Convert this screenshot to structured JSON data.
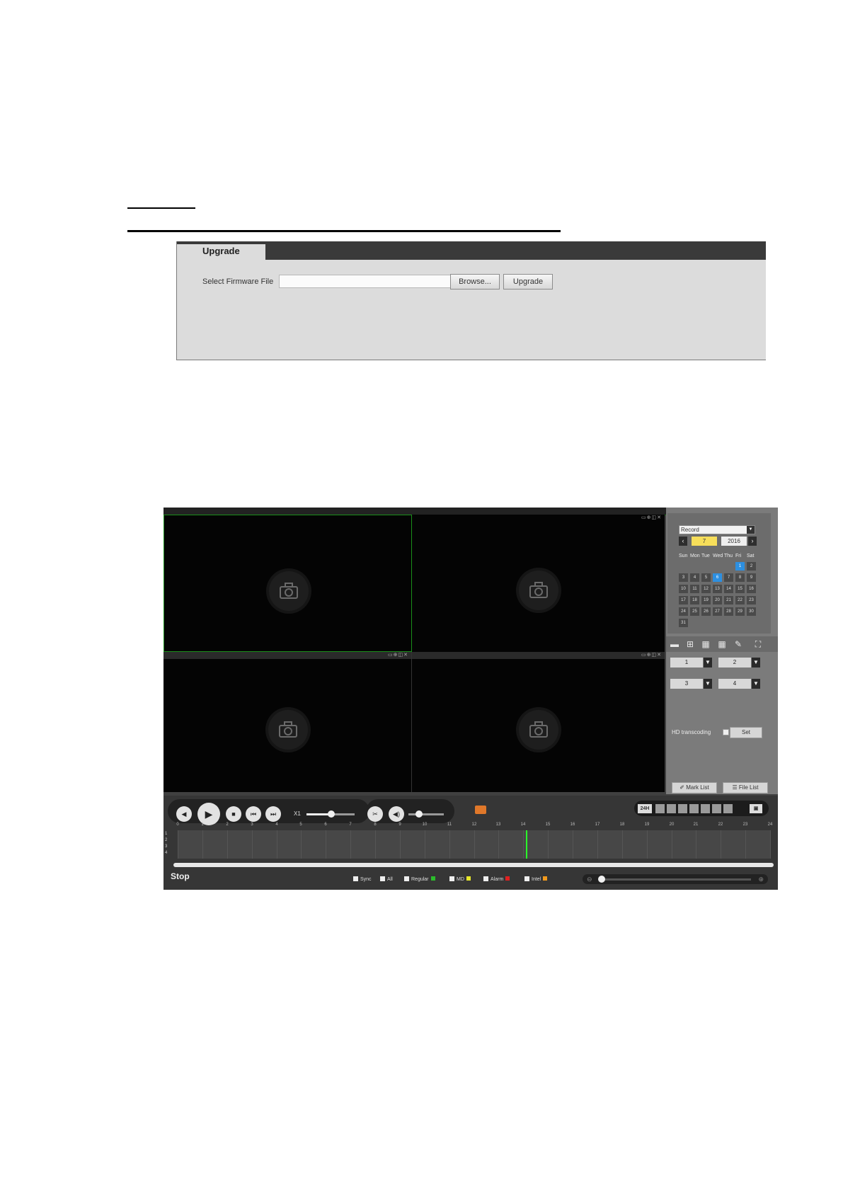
{
  "upgrade": {
    "tab_label": "Upgrade",
    "select_label": "Select Firmware File",
    "file_value": "",
    "browse_label": "Browse...",
    "upgrade_label": "Upgrade"
  },
  "playback": {
    "record_type": "Record",
    "month": "7",
    "year": "2016",
    "weekdays": [
      "Sun",
      "Mon",
      "Tue",
      "Wed",
      "Thu",
      "Fri",
      "Sat"
    ],
    "days": [
      "1",
      "2",
      "3",
      "4",
      "5",
      "6",
      "7",
      "8",
      "9",
      "10",
      "11",
      "12",
      "13",
      "14",
      "15",
      "16",
      "17",
      "18",
      "19",
      "20",
      "21",
      "22",
      "23",
      "24",
      "25",
      "26",
      "27",
      "28",
      "29",
      "30",
      "31"
    ],
    "highlighted_days": [
      "1",
      "6"
    ],
    "channels": [
      "1",
      "2",
      "3",
      "4"
    ],
    "hd_transcoding_label": "HD transcoding",
    "set_label": "Set",
    "mark_list_label": "Mark List",
    "file_list_label": "File List",
    "speed_label": "X1",
    "status": "Stop",
    "timeline_hours": [
      "0",
      "1",
      "2",
      "3",
      "4",
      "5",
      "6",
      "7",
      "8",
      "9",
      "10",
      "11",
      "12",
      "13",
      "14",
      "15",
      "16",
      "17",
      "18",
      "19",
      "20",
      "21",
      "22",
      "23",
      "24"
    ],
    "timeline_channels": [
      "1",
      "2",
      "3",
      "4"
    ],
    "legend": {
      "sync": "Sync",
      "all": "All",
      "regular": "Regular",
      "md": "MD",
      "alarm": "Alarm",
      "intel": "Intel"
    },
    "colors": {
      "regular": "#2bbd2b",
      "md": "#e6e62a",
      "alarm": "#e02020",
      "intel": "#f29a1c",
      "highlight": "#2d8fe0",
      "month": "#f7de5a"
    }
  }
}
